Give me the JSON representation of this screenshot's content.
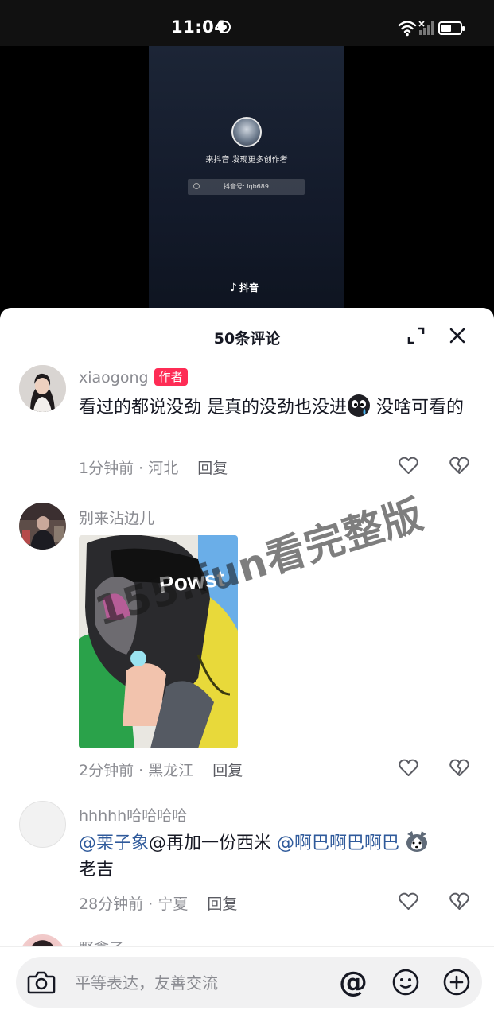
{
  "status_bar": {
    "time": "11:04"
  },
  "video": {
    "tagline": "来抖音 发现更多创作者",
    "search_id": "抖音号: lqb689",
    "logo": "抖音"
  },
  "sheet": {
    "title": "50条评论"
  },
  "comments": [
    {
      "username": "xiaogong",
      "badge": "作者",
      "text_part1": "看过的都说没劲 是真的没劲也没进",
      "text_part2": " 没啥可看的",
      "time": "1分钟前",
      "location": "河北",
      "reply": "回复"
    },
    {
      "username": "别来沾边儿",
      "time": "2分钟前",
      "location": "黑龙江",
      "reply": "回复"
    },
    {
      "username": "hhhhh哈哈哈哈",
      "mention1": "@栗子象",
      "text_mid": "@再加一份西米 ",
      "mention2": "@啊巴啊巴啊巴",
      "text_end": "老吉",
      "time": "28分钟前",
      "location": "宁夏",
      "reply": "回复"
    },
    {
      "username": "野禽子"
    }
  ],
  "watermark": "155.fun看完整版",
  "input": {
    "placeholder": "平等表达，友善交流"
  },
  "colors": {
    "accent": "#fe2c55",
    "mention": "#2f5a9b"
  }
}
